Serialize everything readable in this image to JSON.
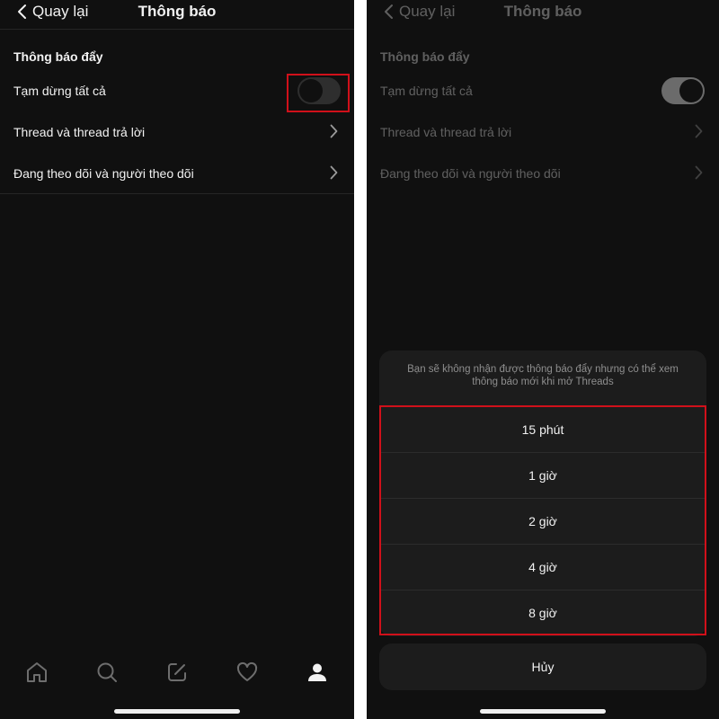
{
  "nav": {
    "back_label": "Quay lại",
    "title": "Thông báo"
  },
  "section_title": "Thông báo đẩy",
  "settings": [
    {
      "label": "Tạm dừng tất cả"
    },
    {
      "label": "Thread và thread trả lời"
    },
    {
      "label": "Đang theo dõi và người theo dõi"
    }
  ],
  "pause_toggle": {
    "left_on": false,
    "right_on": true
  },
  "sheet": {
    "message": "Bạn sẽ không nhận được thông báo đẩy nhưng có thể xem thông báo mới khi mở Threads",
    "options": [
      "15 phút",
      "1 giờ",
      "2 giờ",
      "4 giờ",
      "8 giờ"
    ],
    "cancel_label": "Hủy"
  },
  "tabs": [
    "home-icon",
    "search-icon",
    "compose-icon",
    "heart-icon",
    "profile-icon"
  ],
  "colors": {
    "background": "#101010",
    "highlight": "#d0101a",
    "sheet": "#1c1c1c"
  }
}
